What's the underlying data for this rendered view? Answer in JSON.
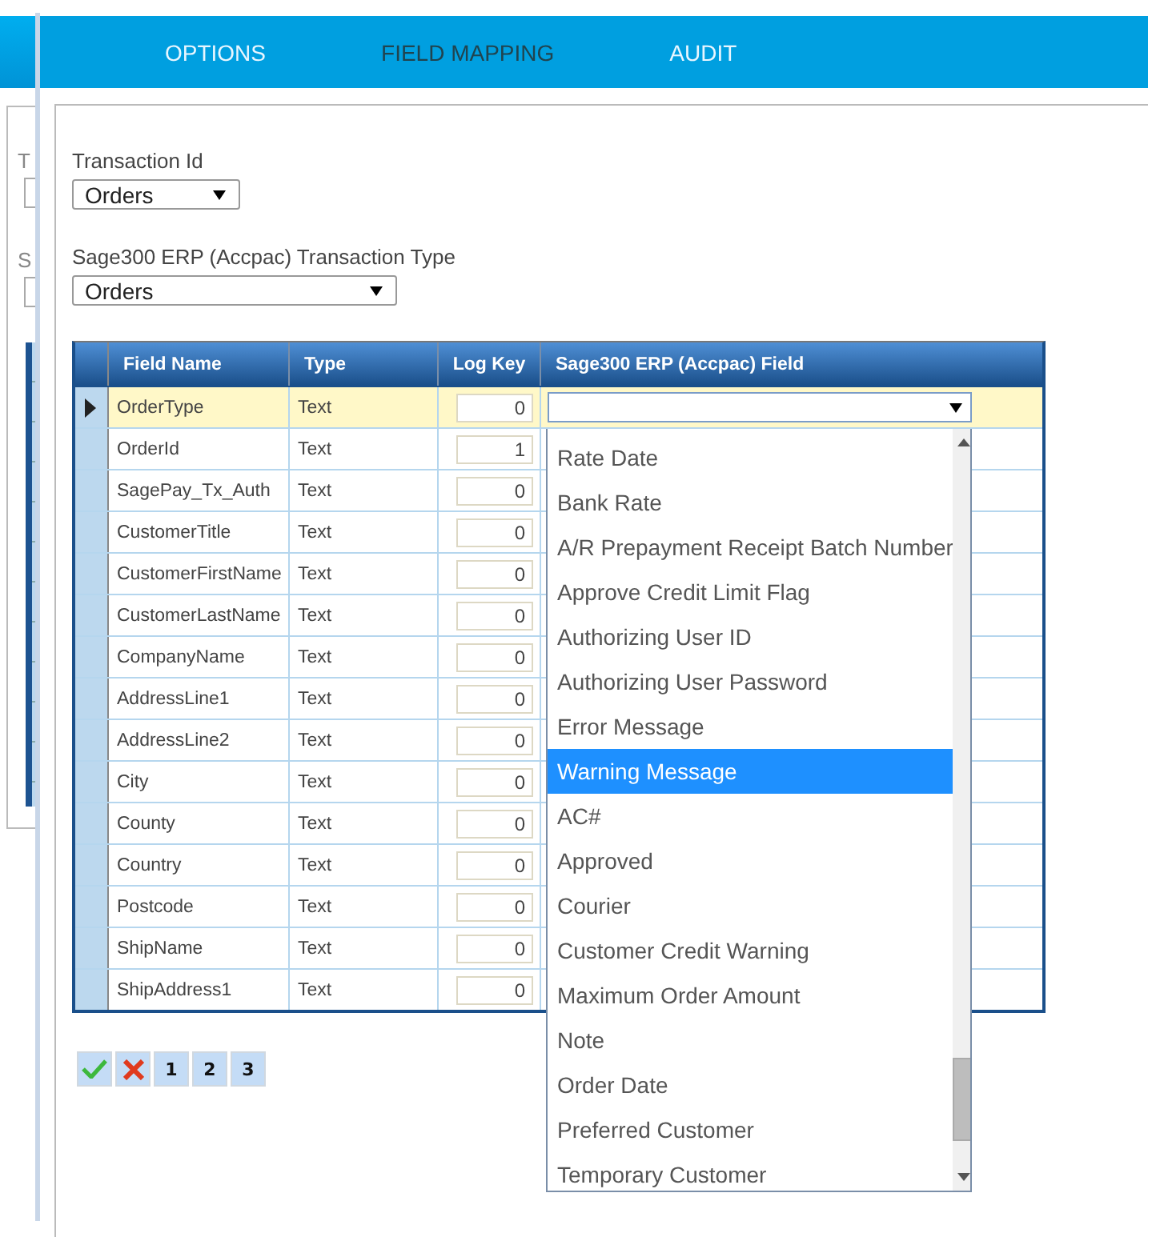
{
  "background_window": {
    "labels": [
      "T",
      "S"
    ]
  },
  "tabs": [
    {
      "label": "OPTIONS",
      "selected": false
    },
    {
      "label": "FIELD MAPPING",
      "selected": true
    },
    {
      "label": "AUDIT",
      "selected": false
    }
  ],
  "transaction_id": {
    "label": "Transaction Id",
    "value": "Orders"
  },
  "transaction_type": {
    "label": "Sage300 ERP (Accpac) Transaction Type",
    "value": "Orders"
  },
  "table": {
    "columns": [
      "Field Name",
      "Type",
      "Log Key",
      "Sage300 ERP (Accpac) Field"
    ],
    "rows": [
      {
        "field_name": "OrderType",
        "type": "Text",
        "log_key": "0",
        "selected": true
      },
      {
        "field_name": "OrderId",
        "type": "Text",
        "log_key": "1",
        "selected": false
      },
      {
        "field_name": "SagePay_Tx_Auth",
        "type": "Text",
        "log_key": "0",
        "selected": false
      },
      {
        "field_name": "CustomerTitle",
        "type": "Text",
        "log_key": "0",
        "selected": false
      },
      {
        "field_name": "CustomerFirstName",
        "type": "Text",
        "log_key": "0",
        "selected": false
      },
      {
        "field_name": "CustomerLastName",
        "type": "Text",
        "log_key": "0",
        "selected": false
      },
      {
        "field_name": "CompanyName",
        "type": "Text",
        "log_key": "0",
        "selected": false
      },
      {
        "field_name": "AddressLine1",
        "type": "Text",
        "log_key": "0",
        "selected": false
      },
      {
        "field_name": "AddressLine2",
        "type": "Text",
        "log_key": "0",
        "selected": false
      },
      {
        "field_name": "City",
        "type": "Text",
        "log_key": "0",
        "selected": false
      },
      {
        "field_name": "County",
        "type": "Text",
        "log_key": "0",
        "selected": false
      },
      {
        "field_name": "Country",
        "type": "Text",
        "log_key": "0",
        "selected": false
      },
      {
        "field_name": "Postcode",
        "type": "Text",
        "log_key": "0",
        "selected": false
      },
      {
        "field_name": "ShipName",
        "type": "Text",
        "log_key": "0",
        "selected": false
      },
      {
        "field_name": "ShipAddress1",
        "type": "Text",
        "log_key": "0",
        "selected": false
      }
    ]
  },
  "dropdown": {
    "expanded": true,
    "items": [
      {
        "label": "Rate Date",
        "selected": false
      },
      {
        "label": "Bank Rate",
        "selected": false
      },
      {
        "label": "A/R Prepayment Receipt Batch Number",
        "selected": false
      },
      {
        "label": "Approve Credit Limit Flag",
        "selected": false
      },
      {
        "label": "Authorizing User ID",
        "selected": false
      },
      {
        "label": "Authorizing User Password",
        "selected": false
      },
      {
        "label": "Error Message",
        "selected": false
      },
      {
        "label": "Warning Message",
        "selected": true
      },
      {
        "label": "AC#",
        "selected": false
      },
      {
        "label": "Approved",
        "selected": false
      },
      {
        "label": "Courier",
        "selected": false
      },
      {
        "label": "Customer Credit Warning",
        "selected": false
      },
      {
        "label": "Maximum Order Amount",
        "selected": false
      },
      {
        "label": "Note",
        "selected": false
      },
      {
        "label": "Order Date",
        "selected": false
      },
      {
        "label": "Preferred Customer",
        "selected": false
      },
      {
        "label": "Temporary Customer",
        "selected": false
      }
    ]
  },
  "pager": {
    "pages": [
      {
        "label": "1"
      },
      {
        "label": "2"
      },
      {
        "label": "3"
      }
    ]
  }
}
